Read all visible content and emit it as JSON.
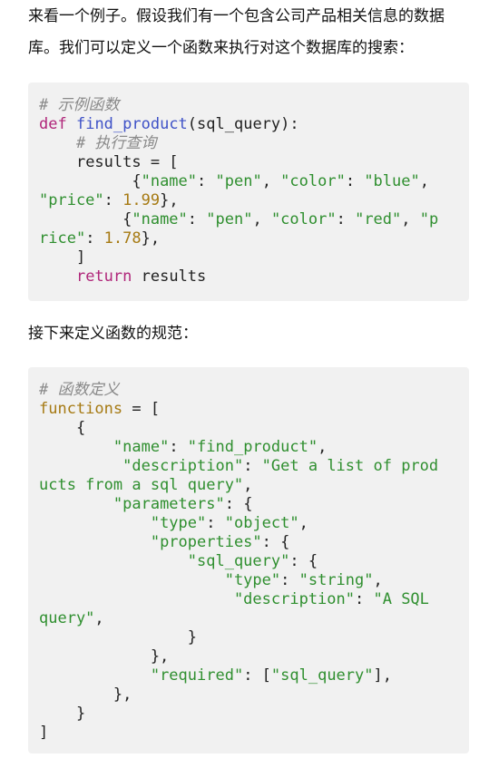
{
  "paragraphs": {
    "intro_line1": "来看一个例子。假设我们有一个包含公司产品相关信息的数据",
    "intro_line2": "库。我们可以定义一个函数来执行对这个数据库的搜索：",
    "spec_intro": "接下来定义函数的规范："
  },
  "code1": {
    "comment_title": "# 示例函数",
    "kw_def": "def",
    "func_name": "find_product",
    "params": "(sql_query):",
    "comment_exec": "# 执行查询",
    "results_assign": "results = [",
    "key_name": "\"name\"",
    "val_pen": "\"pen\"",
    "key_color": "\"color\"",
    "val_blue": "\"blue\"",
    "key_price_wrapped": "\"price\"",
    "val_199": "1.99",
    "val_red": "\"red\"",
    "key_price_part1": "\"p",
    "key_price_part2": "rice\"",
    "val_178": "1.78",
    "close_bracket": "]",
    "kw_return": "return",
    "return_val": "results"
  },
  "code2": {
    "comment_title": "# 函数定义",
    "functions_assign": "functions",
    "str_name_key": "\"name\"",
    "str_find_product": "\"find_product\"",
    "str_description_key": "\"description\"",
    "str_desc_part1": "\"Get a list of prod",
    "str_desc_part2": "ucts from a sql query\"",
    "str_parameters_key": "\"parameters\"",
    "str_type_key": "\"type\"",
    "str_object": "\"object\"",
    "str_properties_key": "\"properties\"",
    "str_sql_query_key": "\"sql_query\"",
    "str_string": "\"string\"",
    "str_a_sql_part1": "\"A SQL",
    "str_a_sql_part2": "query\"",
    "str_required_key": "\"required\"",
    "str_sql_query_val": "\"sql_query\""
  },
  "colors": {
    "comment": "#8a8a8a",
    "keyword": "#b0267a",
    "function": "#3f52c7",
    "string": "#2f8f2f",
    "number": "#a67a13",
    "block_bg": "#f1f1f1"
  }
}
